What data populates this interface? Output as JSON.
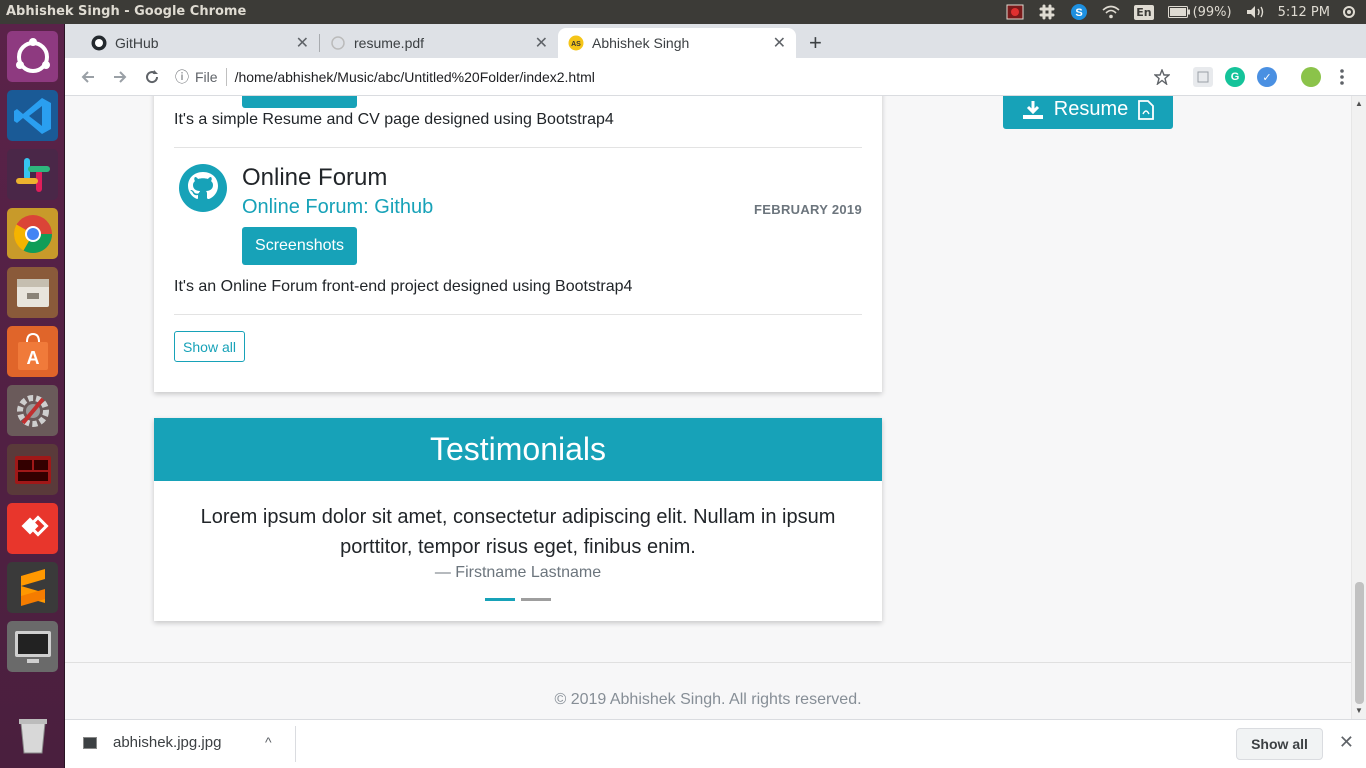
{
  "os": {
    "window_title": "Abhishek Singh - Google Chrome",
    "keyboard": "En",
    "battery": "(99%)",
    "clock": "5:12 PM"
  },
  "browser": {
    "tabs": [
      {
        "label": "GitHub",
        "icon": "github-icon"
      },
      {
        "label": "resume.pdf",
        "icon": "loading-icon"
      },
      {
        "label": "Abhishek Singh",
        "icon": "as-favicon"
      }
    ],
    "new_tab": "+",
    "info": "ⓘ",
    "scheme_label": "File",
    "url": "/home/abhishek/Music/abc/Untitled%20Folder/index2.html"
  },
  "page": {
    "accent": "#17a2b8",
    "projects": {
      "prev_desc": "It's a simple Resume and CV page designed using Bootstrap4",
      "item": {
        "title": "Online Forum",
        "link": "Online Forum: Github",
        "date": "FEBRUARY 2019",
        "button": "Screenshots",
        "desc": "It's an Online Forum front-end project designed using Bootstrap4"
      },
      "show_all": "Show all"
    },
    "testimonials": {
      "title": "Testimonials",
      "quote": "Lorem ipsum dolor sit amet, consectetur adipiscing elit. Nullam in ipsum porttitor, tempor risus eget, finibus enim.",
      "author": "— Firstname Lastname",
      "active_slide": 1,
      "slide_count": 2
    },
    "resume_button": "Resume",
    "footer": "© 2019 Abhishek Singh.  All rights reserved."
  },
  "downloads": {
    "file": "abhishek.jpg.jpg",
    "show_all": "Show all"
  }
}
